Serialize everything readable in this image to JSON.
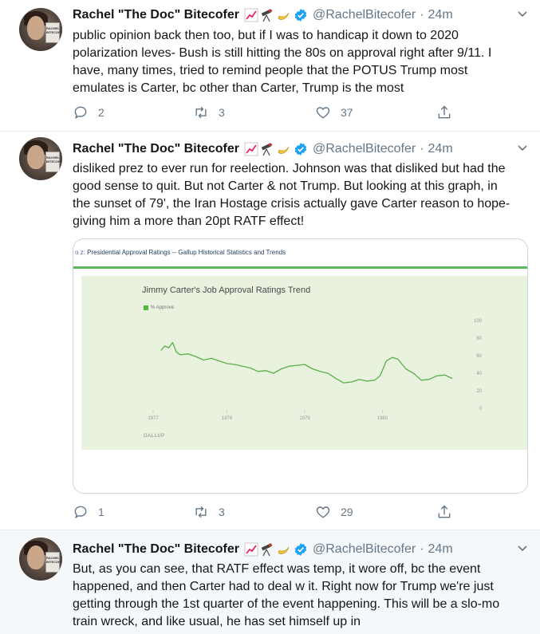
{
  "tweets": [
    {
      "name": "Rachel \"The Doc\" Bitecofer",
      "handle": "@RachelBitecofer",
      "time": "24m",
      "lines": [
        "public opinion back then too, but if I was to handicap it down to 2020",
        "polarization leves- Bush is still hitting the 80s on approval right after 9/11. I",
        "have, many times, tried to remind people that the POTUS Trump most",
        "emulates is Carter, bc other than Carter, Trump is the most"
      ],
      "replies": "2",
      "retweets": "3",
      "likes": "37"
    },
    {
      "name": "Rachel \"The Doc\" Bitecofer",
      "handle": "@RachelBitecofer",
      "time": "24m",
      "lines": [
        "disliked prez to ever run for reelection. Johnson was that disliked but had the",
        "good sense to quit. But not Carter & not Trump. But looking at this graph, in",
        "the sunset of 79', the Iran Hostage crisis actually gave Carter reason to hope-",
        "giving him a more than 20pt RATF effect!"
      ],
      "replies": "1",
      "retweets": "3",
      "likes": "29"
    },
    {
      "name": "Rachel \"The Doc\" Bitecofer",
      "handle": "@RachelBitecofer",
      "time": "24m",
      "lines": [
        "But, as you can see, that RATF effect was temp, it wore off, bc the event",
        "happened, and then Carter had to deal w it. Right now for Trump we're just",
        "getting through the 1st quarter of the event happening. This will be a slo-mo",
        "train wreck, and like usual, he has set himself up in"
      ]
    }
  ],
  "avatar_text": "RACHEL BITECOFER",
  "icons": {
    "emoji_1": "chart-increasing-icon",
    "emoji_2": "telescope-icon",
    "emoji_3": "banana-icon",
    "verified": "verified-badge-icon",
    "caret": "chevron-down-icon",
    "reply": "reply-icon",
    "retweet": "retweet-icon",
    "like": "heart-icon",
    "share": "share-icon"
  },
  "embed": {
    "source_prefix": "o z:",
    "source_title": "Presidential Approval Ratings -- Gallup Historical Statistics and Trends",
    "credit": "GALLUP"
  },
  "colors": {
    "accent": "#1da1f2",
    "muted": "#657786",
    "chart_line": "#58b246",
    "chart_bg": "#e9f1df"
  },
  "chart_data": {
    "type": "line",
    "title": "Jimmy Carter's Job Approval Ratings Trend",
    "legend": "% Approve",
    "ylim": [
      0,
      100
    ],
    "yticks": [
      "100",
      "80",
      "60",
      "40",
      "20",
      "0"
    ],
    "xticks": [
      "1977",
      "1978",
      "1979",
      "1980"
    ],
    "series": [
      {
        "name": "% Approve",
        "x": [
          1977.1,
          1977.15,
          1977.2,
          1977.25,
          1977.3,
          1977.35,
          1977.45,
          1977.55,
          1977.65,
          1977.75,
          1977.85,
          1977.95,
          1978.05,
          1978.15,
          1978.25,
          1978.35,
          1978.45,
          1978.55,
          1978.65,
          1978.75,
          1978.85,
          1978.95,
          1979.05,
          1979.15,
          1979.25,
          1979.35,
          1979.45,
          1979.55,
          1979.65,
          1979.75,
          1979.85,
          1979.92,
          1980.0,
          1980.08,
          1980.15,
          1980.25,
          1980.35,
          1980.45,
          1980.55,
          1980.65,
          1980.75,
          1980.85
        ],
        "y": [
          66,
          71,
          69,
          75,
          64,
          61,
          62,
          59,
          55,
          57,
          54,
          51,
          50,
          48,
          46,
          42,
          43,
          40,
          45,
          48,
          49,
          50,
          45,
          42,
          40,
          34,
          29,
          30,
          33,
          31,
          32,
          37,
          54,
          58,
          56,
          45,
          40,
          32,
          33,
          37,
          38,
          34
        ]
      }
    ]
  }
}
